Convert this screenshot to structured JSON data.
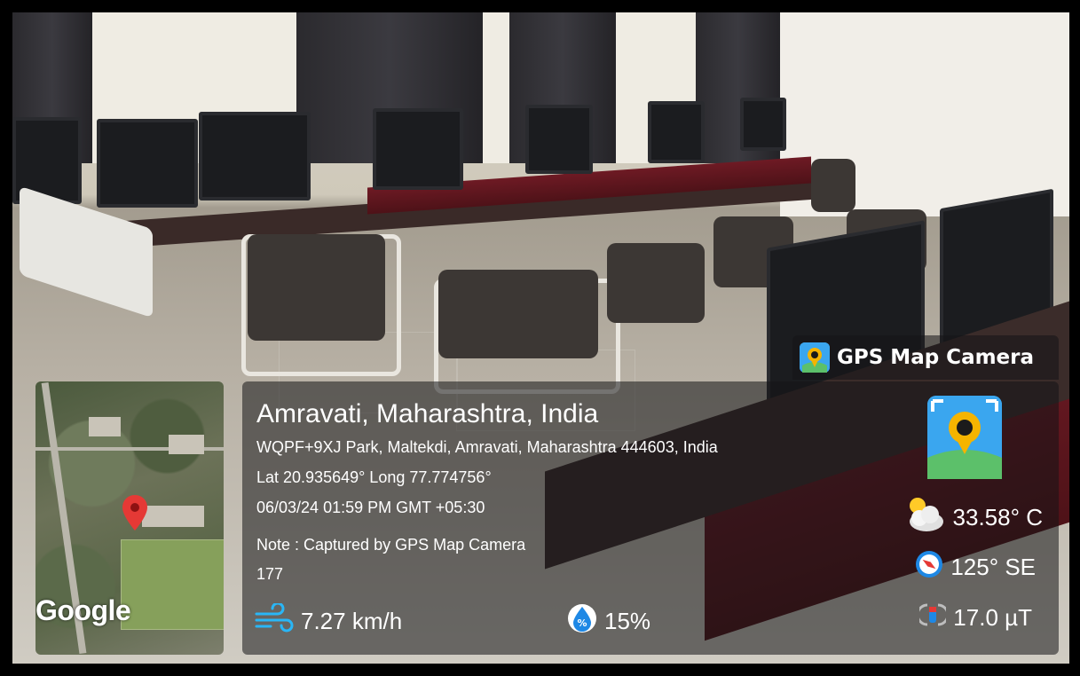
{
  "badge": {
    "label": "GPS Map Camera",
    "icon": "gps-map-camera-icon"
  },
  "location": {
    "city": "Amravati, Maharashtra, India",
    "address": "WQPF+9XJ Park, Maltekdi, Amravati, Maharashtra 444603, India",
    "latlong": "Lat 20.935649° Long 77.774756°",
    "datetime": "06/03/24 01:59 PM GMT +05:30",
    "note": "Note : Captured by GPS Map Camera",
    "extra": "177"
  },
  "metrics": {
    "wind": "7.27 km/h",
    "humidity": "15%",
    "temperature": "33.58° C",
    "compass": "125° SE",
    "magnetic": "17.0 µT"
  },
  "map": {
    "provider_logo": "Google",
    "pin_color": "#e53935"
  },
  "icons": {
    "wind": "wind-icon",
    "humidity": "humidity-icon",
    "weather": "partly-cloudy-icon",
    "compass": "compass-icon",
    "magnetic": "magnet-icon"
  }
}
